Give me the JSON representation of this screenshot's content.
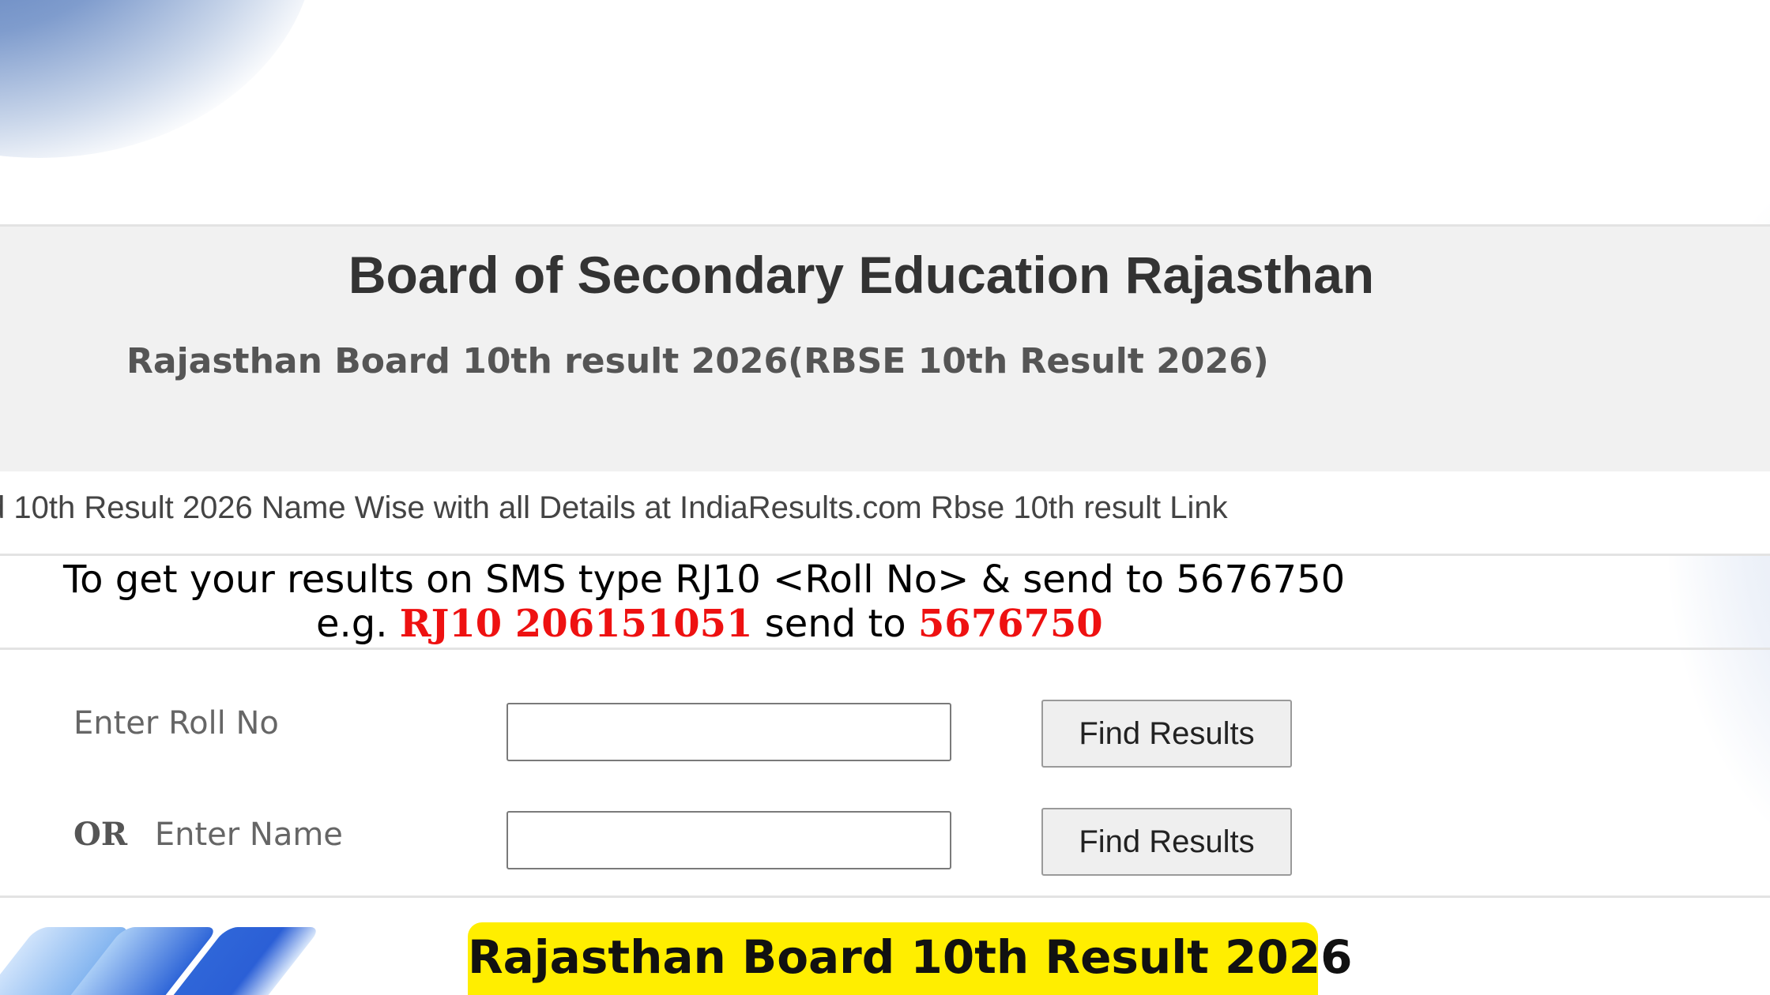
{
  "header": {
    "title": "Board of Secondary Education Rajasthan",
    "subtitle": "Rajasthan Board 10th result 2026(RBSE 10th Result 2026)"
  },
  "link": {
    "text": "d 10th Result 2026 Name Wise with all Details at IndiaResults.com Rbse 10th result Link"
  },
  "sms": {
    "line1": "To get your results on SMS type RJ10 <Roll No> & send to 5676750",
    "eg_prefix": "e.g.",
    "example_code": "RJ10 206151051",
    "send_to_text": "send to",
    "number": "5676750"
  },
  "form": {
    "roll_label": "Enter Roll No",
    "roll_value": "",
    "or_label": "OR",
    "name_label": "Enter Name",
    "name_value": "",
    "find_results_label": "Find Results"
  },
  "banner": {
    "text": "Rajasthan Board 10th Result 2026"
  },
  "colors": {
    "highlight_red": "#ee1111",
    "banner_yellow": "#ffee00",
    "chevron_blue": "#2f66d8"
  }
}
